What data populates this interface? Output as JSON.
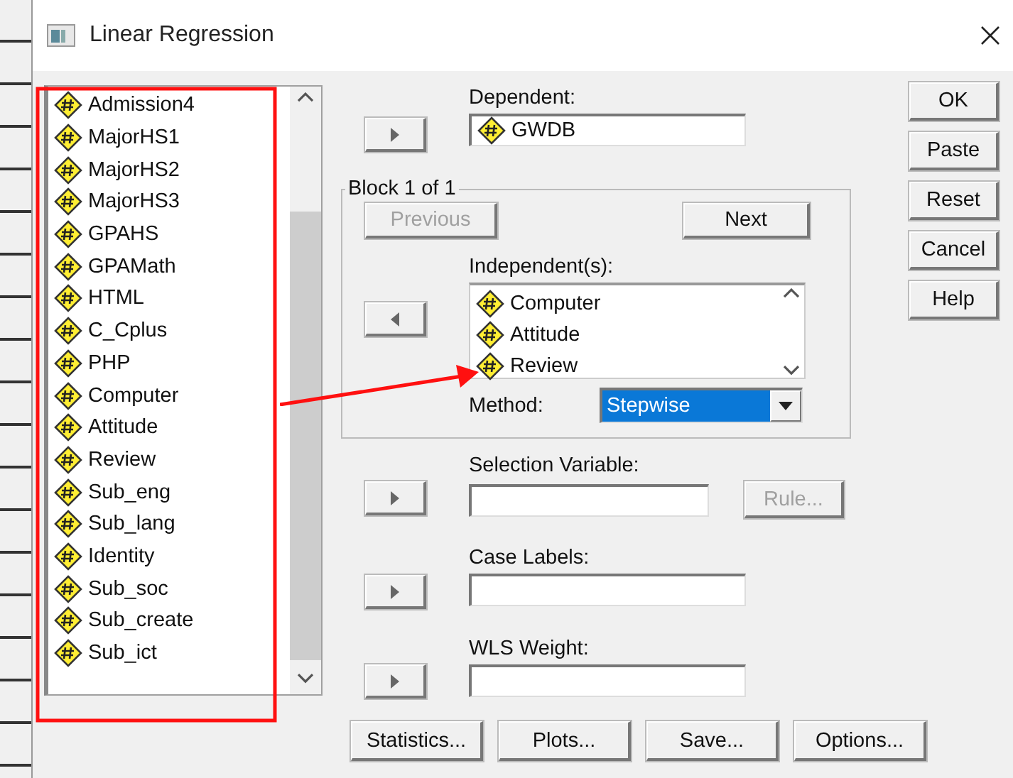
{
  "window": {
    "title": "Linear Regression"
  },
  "variables": [
    "Admission4",
    "MajorHS1",
    "MajorHS2",
    "MajorHS3",
    "GPAHS",
    "GPAMath",
    "HTML",
    "C_Cplus",
    "PHP",
    "Computer",
    "Attitude",
    "Review",
    "Sub_eng",
    "Sub_lang",
    "Identity",
    "Sub_soc",
    "Sub_create",
    "Sub_ict"
  ],
  "dependent": {
    "label": "Dependent:",
    "value": "GWDB",
    "move_button": {
      "kind": "right"
    }
  },
  "block": {
    "title": "Block 1 of 1",
    "previous": {
      "label": "Previous",
      "disabled": true
    },
    "next": {
      "label": "Next",
      "disabled": false
    }
  },
  "independents": {
    "label": "Independent(s):",
    "items": [
      "Computer",
      "Attitude",
      "Review"
    ],
    "move_button": {
      "kind": "left"
    }
  },
  "method": {
    "label": "Method:",
    "value": "Stepwise",
    "selected": true
  },
  "selection_variable": {
    "label": "Selection Variable:",
    "move_button": {
      "kind": "right"
    },
    "rule": {
      "label": "Rule...",
      "disabled": true
    }
  },
  "case_labels": {
    "label": "Case Labels:",
    "move_button": {
      "kind": "right"
    }
  },
  "wls_weight": {
    "label": "WLS Weight:",
    "move_button": {
      "kind": "right"
    }
  },
  "actions": [
    "Statistics...",
    "Plots...",
    "Save...",
    "Options..."
  ],
  "dialog_buttons": [
    "OK",
    "Paste",
    "Reset",
    "Cancel",
    "Help"
  ]
}
